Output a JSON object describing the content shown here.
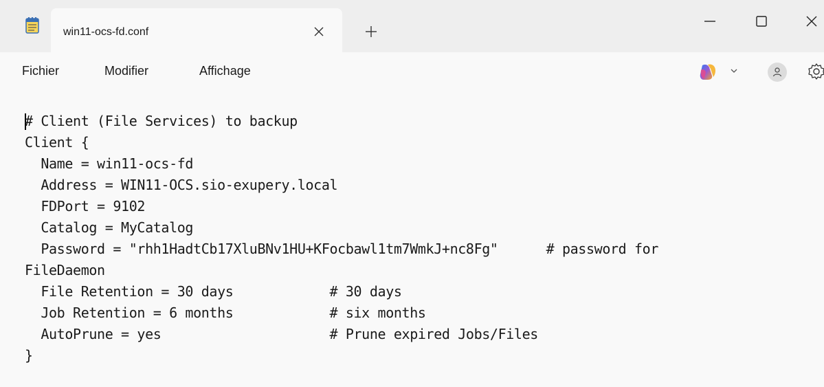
{
  "window": {
    "tab_title": "win11-ocs-fd.conf",
    "icons": {
      "app": "notepad-icon",
      "close_tab": "close-icon",
      "new_tab": "plus-icon",
      "minimize": "minimize-icon",
      "maximize": "maximize-icon",
      "close_window": "close-icon"
    }
  },
  "menu": {
    "items": [
      "Fichier",
      "Modifier",
      "Affichage"
    ],
    "right_icons": [
      "copilot-icon",
      "chevron-down-icon",
      "account-icon",
      "gear-icon"
    ]
  },
  "editor": {
    "lines": [
      "# Client (File Services) to backup",
      "Client {",
      "  Name = win11-ocs-fd",
      "  Address = WIN11-OCS.sio-exupery.local",
      "  FDPort = 9102",
      "  Catalog = MyCatalog",
      "  Password = \"rhh1HadtCb17XluBNv1HU+KFocbawl1tm7WmkJ+nc8Fg\"      # password for",
      "FileDaemon",
      "  File Retention = 30 days            # 30 days",
      "  Job Retention = 6 months            # six months",
      "  AutoPrune = yes                     # Prune expired Jobs/Files",
      "}"
    ]
  },
  "colors": {
    "titlebar": "#eeeeee",
    "background": "#f9f9f9",
    "text": "#1a1a1a"
  }
}
